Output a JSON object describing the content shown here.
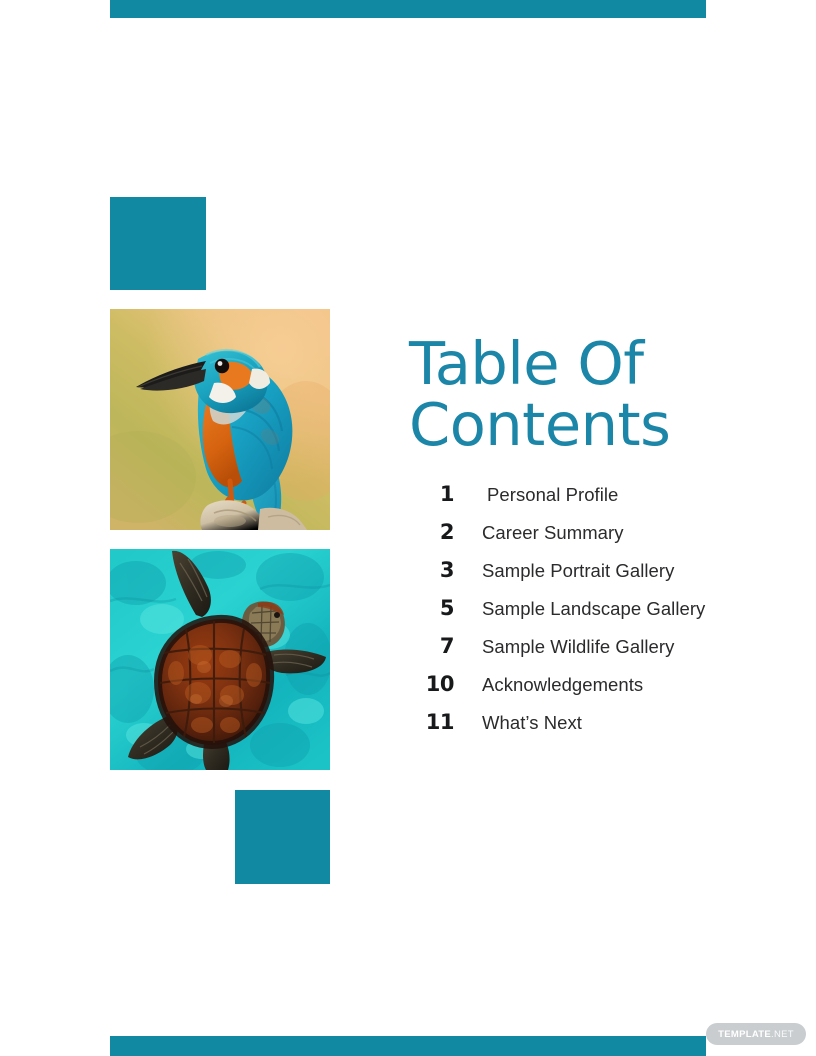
{
  "document": {
    "title": "Table Of Contents",
    "title_lines": "Table Of\nContents",
    "background_color": "#ffffff",
    "accent_color": "#1189a3",
    "title_color": "#1b86a8",
    "number_color": "#18191b",
    "label_color": "#2b2b2d"
  },
  "decorations": {
    "top_bar_color": "#1189a3",
    "bottom_bar_color": "#1189a3",
    "square_top_color": "#1189a3",
    "square_bottom_color": "#1189a3"
  },
  "photos": [
    {
      "name": "kingfisher-bird",
      "alt": "Kingfisher bird with turquoise plumage and orange breast perched on a pale rock",
      "subject": "bird",
      "background": "warm olive and orange gradient"
    },
    {
      "name": "sea-turtle",
      "alt": "Sea turtle with dark reddish-brown shell swimming in bright turquoise water",
      "subject": "turtle",
      "background": "turquoise ocean water"
    }
  ],
  "toc": {
    "items": [
      {
        "number": "1",
        "label": "Personal Profile",
        "indented": true
      },
      {
        "number": "2",
        "label": "Career Summary",
        "indented": false
      },
      {
        "number": "3",
        "label": "Sample Portrait Gallery",
        "indented": false
      },
      {
        "number": "5",
        "label": "Sample Landscape Gallery",
        "indented": false
      },
      {
        "number": "7",
        "label": "Sample Wildlife Gallery",
        "indented": false
      },
      {
        "number": "10",
        "label": "Acknowledgements",
        "indented": false
      },
      {
        "number": "11",
        "label": "What’s Next",
        "indented": false
      }
    ]
  },
  "watermark": {
    "bold_text": "TEMPLATE",
    "light_text": ".NET",
    "background_color": "#c9cdd0"
  }
}
